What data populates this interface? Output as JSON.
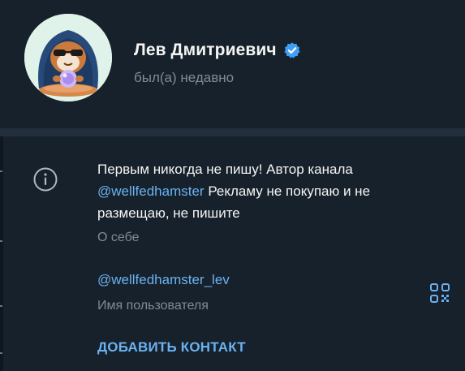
{
  "profile": {
    "name": "Лев Дмитриевич",
    "status": "был(а) недавно",
    "verified_icon": "verified-badge-icon",
    "avatar_icon": "hamster-avatar"
  },
  "info": {
    "bio_line_1": "Первым никогда не пишу! Автор канала",
    "bio_mention": "@wellfedhamster",
    "bio_line_2_rest": " Рекламу не покупаю и не",
    "bio_line_3": "размещаю, не пишите",
    "bio_caption": "О себе",
    "username": "@wellfedhamster_lev",
    "username_caption": "Имя пользователя",
    "add_contact_label": "ДОБАВИТЬ КОНТАКТ"
  },
  "colors": {
    "background": "#17212b",
    "divider": "#232e3c",
    "accent": "#6ab2f2",
    "muted_text": "#7f8b98",
    "verified": "#3f9ff5"
  }
}
